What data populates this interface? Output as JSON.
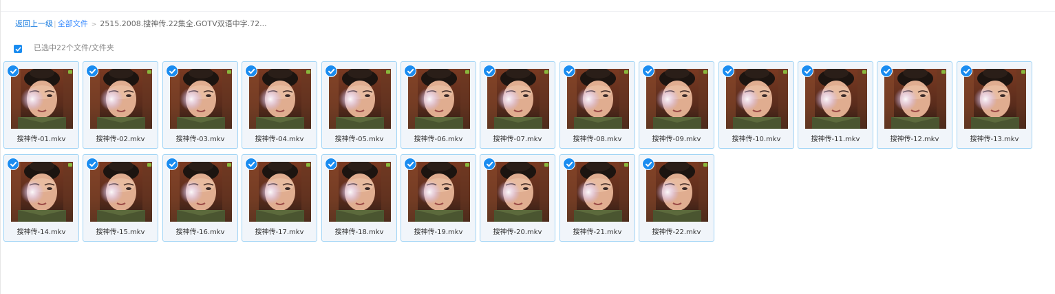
{
  "breadcrumb": {
    "back": "返回上一级",
    "all_files": "全部文件",
    "separator": ">",
    "current": "2515.2008.搜神传.22集全.GOTV双语中字.72..."
  },
  "selection": {
    "text": "已选中22个文件/文件夹",
    "checked": true
  },
  "colors": {
    "accent": "#1a8cf0",
    "tile_border": "#9fd3f5",
    "tile_bg": "#f1f5fa"
  },
  "files": [
    {
      "name": "搜神传-01.mkv",
      "selected": true
    },
    {
      "name": "搜神传-02.mkv",
      "selected": true
    },
    {
      "name": "搜神传-03.mkv",
      "selected": true
    },
    {
      "name": "搜神传-04.mkv",
      "selected": true
    },
    {
      "name": "搜神传-05.mkv",
      "selected": true
    },
    {
      "name": "搜神传-06.mkv",
      "selected": true
    },
    {
      "name": "搜神传-07.mkv",
      "selected": true
    },
    {
      "name": "搜神传-08.mkv",
      "selected": true
    },
    {
      "name": "搜神传-09.mkv",
      "selected": true
    },
    {
      "name": "搜神传-10.mkv",
      "selected": true
    },
    {
      "name": "搜神传-11.mkv",
      "selected": true
    },
    {
      "name": "搜神传-12.mkv",
      "selected": true
    },
    {
      "name": "搜神传-13.mkv",
      "selected": true
    },
    {
      "name": "搜神传-14.mkv",
      "selected": true
    },
    {
      "name": "搜神传-15.mkv",
      "selected": true
    },
    {
      "name": "搜神传-16.mkv",
      "selected": true
    },
    {
      "name": "搜神传-17.mkv",
      "selected": true
    },
    {
      "name": "搜神传-18.mkv",
      "selected": true
    },
    {
      "name": "搜神传-19.mkv",
      "selected": true
    },
    {
      "name": "搜神传-20.mkv",
      "selected": true
    },
    {
      "name": "搜神传-21.mkv",
      "selected": true
    },
    {
      "name": "搜神传-22.mkv",
      "selected": true
    }
  ]
}
